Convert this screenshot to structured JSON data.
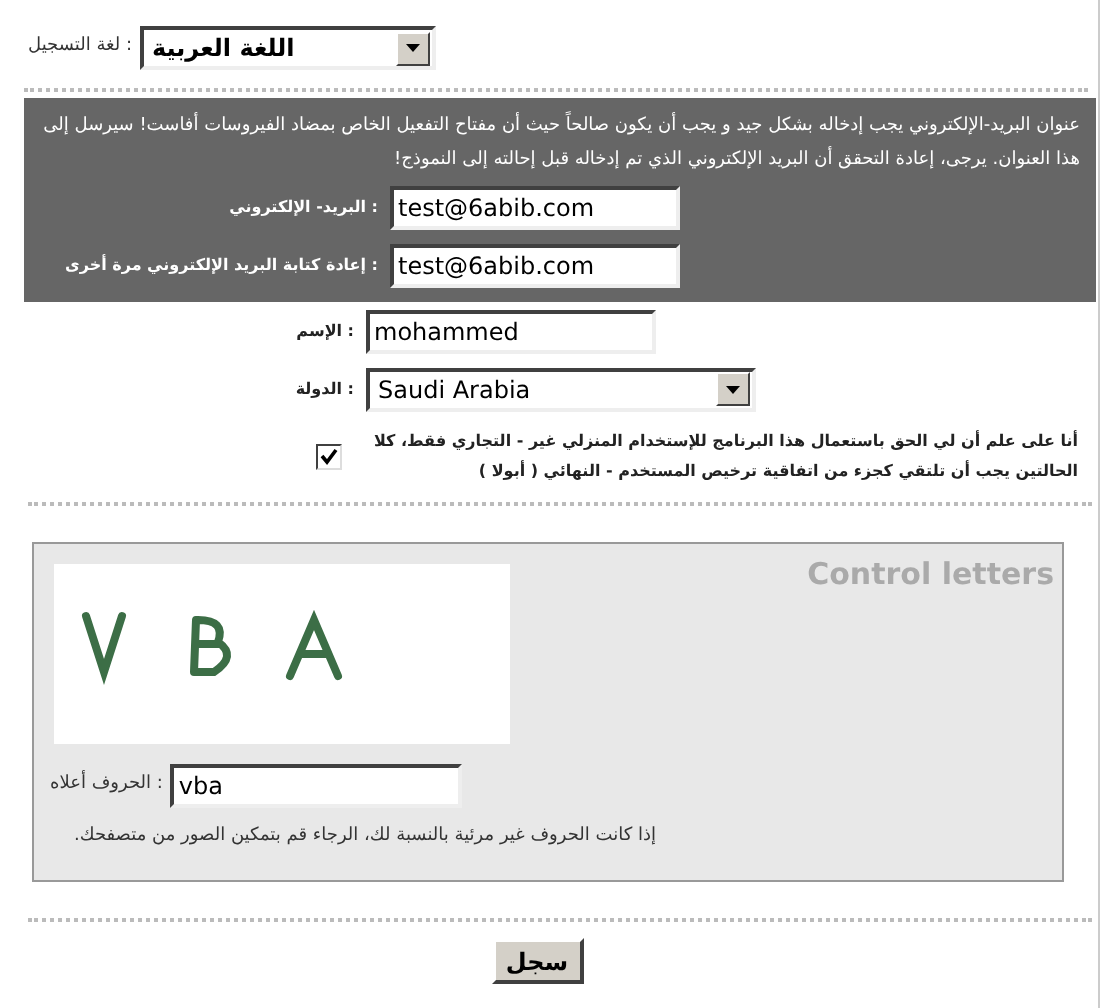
{
  "language": {
    "label": ": لغة التسجيل",
    "value": "اللغة العربية"
  },
  "notice": "عنوان البريد-الإلكتروني يجب إدخاله بشكل جيد و يجب أن يكون صالحاً حيث أن مفتاح التفعيل الخاص بمضاد الفيروسات أفاست! سيرسل إلى هذا العنوان. يرجى، إعادة التحقق أن البريد الإلكتروني الذي تم إدخاله قبل إحالته إلى النموذج!",
  "email_fields": [
    {
      "kind": "input",
      "label": ": البريد- الإلكتروني",
      "value": "test@6abib.com"
    },
    {
      "kind": "input",
      "label": ": إعادة كتابة البريد الإلكتروني مرة أخرى",
      "value": "test@6abib.com"
    }
  ],
  "fields": [
    {
      "kind": "input",
      "label": ": الإسم",
      "value": "mohammed"
    },
    {
      "kind": "select",
      "label": ": الدولة",
      "value": "Saudi Arabia"
    }
  ],
  "agreement": {
    "checked": true,
    "text": "أنا على علم أن لي الحق باستعمال هذا البرنامج للإستخدام المنزلي غير - التجاري فقط، كلا الحالتين يجب أن تلتقي كجزء من اتفاقية ترخيص المستخدم - النهائي ( أبولا )"
  },
  "captcha": {
    "title": "Control letters",
    "label": ": الحروف أعلاه",
    "value": "vba",
    "note": "إذا كانت الحروف غير مرئية بالنسبة لك، الرجاء قم بتمكين الصور من متصفحك."
  },
  "submit": "سجل"
}
